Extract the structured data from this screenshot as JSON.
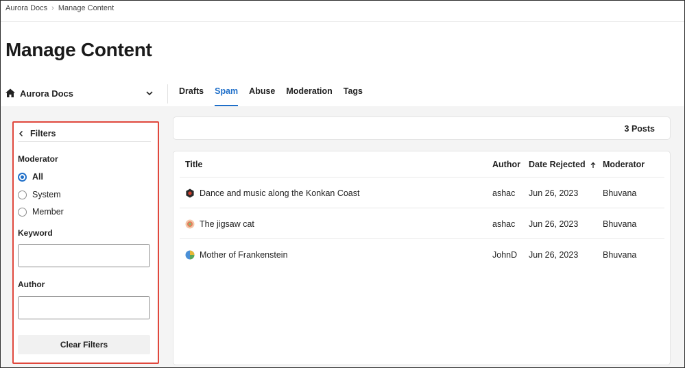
{
  "breadcrumb": {
    "items": [
      "Aurora Docs",
      "Manage Content"
    ]
  },
  "page": {
    "title": "Manage Content"
  },
  "community": {
    "selected": "Aurora Docs",
    "icon": "home-icon"
  },
  "tabs": [
    {
      "label": "Drafts",
      "active": false
    },
    {
      "label": "Spam",
      "active": true
    },
    {
      "label": "Abuse",
      "active": false
    },
    {
      "label": "Moderation",
      "active": false
    },
    {
      "label": "Tags",
      "active": false
    }
  ],
  "filters": {
    "title": "Filters",
    "moderator_label": "Moderator",
    "moderator_options": [
      {
        "label": "All",
        "checked": true
      },
      {
        "label": "System",
        "checked": false
      },
      {
        "label": "Member",
        "checked": false
      }
    ],
    "keyword_label": "Keyword",
    "keyword_value": "",
    "author_label": "Author",
    "author_value": "",
    "clear_label": "Clear Filters"
  },
  "posts": {
    "count_label": "3 Posts"
  },
  "table": {
    "columns": {
      "title": "Title",
      "author": "Author",
      "date": "Date Rejected",
      "moderator": "Moderator"
    },
    "rows": [
      {
        "title": "Dance and music along the Konkan Coast",
        "author": "ashac",
        "date": "Jun 26, 2023",
        "moderator": "Bhuvana",
        "icon": "hexagon-avatar-icon"
      },
      {
        "title": "The jigsaw cat",
        "author": "ashac",
        "date": "Jun 26, 2023",
        "moderator": "Bhuvana",
        "icon": "sunburst-avatar-icon"
      },
      {
        "title": "Mother of Frankenstein",
        "author": "JohnD",
        "date": "Jun 26, 2023",
        "moderator": "Bhuvana",
        "icon": "circle-avatar-icon"
      }
    ]
  },
  "colors": {
    "accent": "#1f6fc9",
    "highlight_border": "#e0473c",
    "background": "#f4f4f4"
  }
}
